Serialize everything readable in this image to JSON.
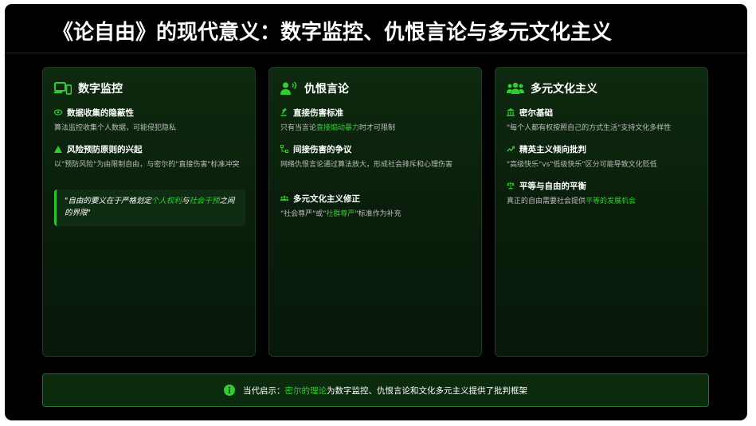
{
  "title": "《论自由》的现代意义：数字监控、仇恨言论与多元文化主义",
  "colors": {
    "accent": "#33cc33",
    "background": "#000000",
    "card": "#0a1f0b"
  },
  "cards": [
    {
      "icon": "devices-icon",
      "title": "数字监控",
      "items": [
        {
          "icon": "eye-icon",
          "title": "数据收集的隐蔽性",
          "desc": "算法监控收集个人数据，可能侵犯隐私"
        },
        {
          "icon": "warning-triangle-icon",
          "title": "风险预防原则的兴起",
          "desc": "以\"预防风险\"为由限制自由，与密尔的\"直接伤害\"标准冲突"
        }
      ],
      "quote": {
        "pre": "\"自由的要义在于严格划定",
        "hl1": "个人权利",
        "mid": "与",
        "hl2": "社会干预",
        "post": "之间的界限\""
      }
    },
    {
      "icon": "speaking-person-icon",
      "title": "仇恨言论",
      "items": [
        {
          "icon": "gavel-icon",
          "title": "直接伤害标准",
          "desc_pre": "只有当言论",
          "desc_hl": "直接煽动暴力",
          "desc_post": "时才可限制"
        },
        {
          "icon": "network-icon",
          "title": "间接伤害的争议",
          "desc": "网络仇恨言论通过算法放大，形成社会排斥和心理伤害"
        },
        {
          "icon": "group-icon",
          "title": "多元文化主义修正",
          "desc_pre": "\"社会尊严\"或\"",
          "desc_hl": "社群尊严",
          "desc_post": "\"标准作为补充"
        }
      ]
    },
    {
      "icon": "people-group-icon",
      "title": "多元文化主义",
      "items": [
        {
          "icon": "temple-icon",
          "title": "密尔基础",
          "desc": "\"每个人都有权按照自己的方式生活\"支持文化多样性"
        },
        {
          "icon": "trend-up-icon",
          "title": "精英主义倾向批判",
          "desc": "\"高级快乐\"vs\"低级快乐\"区分可能导致文化贬低"
        },
        {
          "icon": "balance-scale-icon",
          "title": "平等与自由的平衡",
          "desc_pre": "真正的自由需要社会提供",
          "desc_hl": "平等的发展机会",
          "desc_post": ""
        }
      ]
    }
  ],
  "footer": {
    "icon": "info-icon",
    "label": "当代启示：",
    "hl": "密尔的理论",
    "text": "为数字监控、仇恨言论和文化多元主义提供了批判框架"
  }
}
